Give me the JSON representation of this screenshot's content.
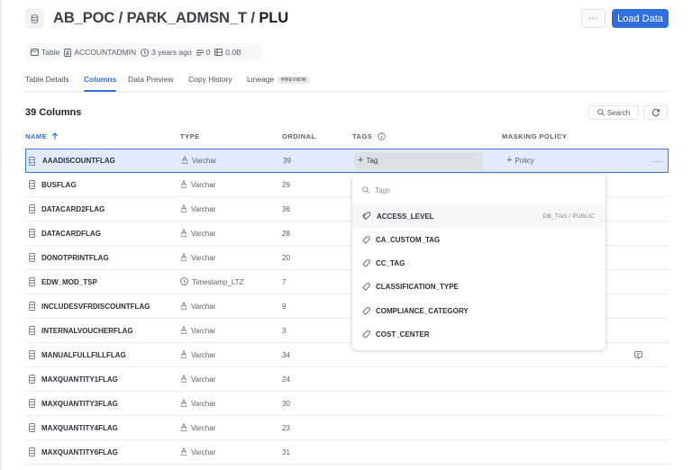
{
  "header": {
    "title_prefix": "AB_POC / PARK_ADMSN_T / ",
    "title_last": "PLU",
    "more_label": "···",
    "load_button": "Load Data",
    "icon": "database-icon"
  },
  "meta": {
    "kind": "Table",
    "owner": "ACCOUNTADMIN",
    "age": "3 years ago",
    "rows": "0",
    "size": "0.0B"
  },
  "tabs": [
    {
      "label": "Table Details",
      "active": false
    },
    {
      "label": "Columns",
      "active": true
    },
    {
      "label": "Data Preview",
      "active": false
    },
    {
      "label": "Copy History",
      "active": false
    },
    {
      "label": "Lineage",
      "active": false,
      "badge": "PREVIEW"
    }
  ],
  "columns_section": {
    "count_title": "39 Columns",
    "search_label": "Search",
    "headers": {
      "name": "NAME",
      "type": "TYPE",
      "ordinal": "ORDINAL",
      "tags": "TAGS",
      "masking_policy": "MASKING POLICY"
    },
    "sort": {
      "column": "name",
      "direction": "ascending"
    },
    "add_tag_label": "Tag",
    "add_policy_label": "Policy",
    "row_more_label": "···",
    "rows": [
      {
        "name": "AAADISCOUNTFLAG",
        "type": "Varchar",
        "type_icon": "text-type-icon",
        "ordinal": "39",
        "selected": true
      },
      {
        "name": "BUSFLAG",
        "type": "Varchar",
        "type_icon": "text-type-icon",
        "ordinal": "29"
      },
      {
        "name": "DATACARD2FLAG",
        "type": "Varchar",
        "type_icon": "text-type-icon",
        "ordinal": "36"
      },
      {
        "name": "DATACARDFLAG",
        "type": "Varchar",
        "type_icon": "text-type-icon",
        "ordinal": "28"
      },
      {
        "name": "DONOTPRINTFLAG",
        "type": "Varchar",
        "type_icon": "text-type-icon",
        "ordinal": "20"
      },
      {
        "name": "EDW_MOD_TSP",
        "type": "Timestamp_LTZ",
        "type_icon": "clock-icon",
        "ordinal": "7"
      },
      {
        "name": "INCLUDESVFRDISCOUNTFLAG",
        "type": "Varchar",
        "type_icon": "text-type-icon",
        "ordinal": "9"
      },
      {
        "name": "INTERNALVOUCHERFLAG",
        "type": "Varchar",
        "type_icon": "text-type-icon",
        "ordinal": "3"
      },
      {
        "name": "MANUALFULLFILLFLAG",
        "type": "Varchar",
        "type_icon": "text-type-icon",
        "ordinal": "34",
        "has_comment": true
      },
      {
        "name": "MAXQUANTITY1FLAG",
        "type": "Varchar",
        "type_icon": "text-type-icon",
        "ordinal": "24"
      },
      {
        "name": "MAXQUANTITY3FLAG",
        "type": "Varchar",
        "type_icon": "text-type-icon",
        "ordinal": "30"
      },
      {
        "name": "MAXQUANTITY4FLAG",
        "type": "Varchar",
        "type_icon": "text-type-icon",
        "ordinal": "23"
      },
      {
        "name": "MAXQUANTITY6FLAG",
        "type": "Varchar",
        "type_icon": "text-type-icon",
        "ordinal": "31"
      }
    ]
  },
  "tag_dropdown": {
    "search_placeholder": "Tags",
    "items": [
      {
        "label": "ACCESS_LEVEL",
        "path": "DB_TAG / PUBLIC",
        "hovered": true
      },
      {
        "label": "CA_CUSTOM_TAG"
      },
      {
        "label": "CC_TAG"
      },
      {
        "label": "CLASSIFICATION_TYPE"
      },
      {
        "label": "COMPLIANCE_CATEGORY"
      },
      {
        "label": "COST_CENTER"
      }
    ]
  },
  "colors": {
    "accent": "#2f6fe0",
    "selected_row_bg": "#e2eafb",
    "selected_row_border": "#3b78e6"
  }
}
